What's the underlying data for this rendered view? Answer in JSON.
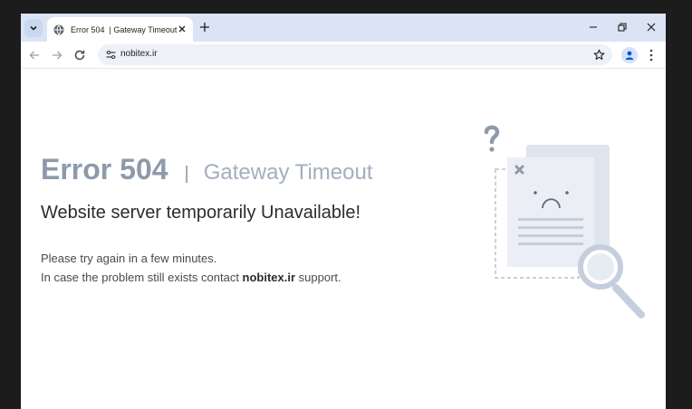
{
  "browser": {
    "tab_title": "Error 504  | Gateway Timeout",
    "url": "nobitex.ir"
  },
  "error": {
    "code": "Error 504",
    "separator": "|",
    "name": "Gateway Timeout",
    "subheading": "Website server temporarily Unavailable!",
    "line1": "Please try again in a few minutes.",
    "line2_prefix": "In case the problem still exists contact ",
    "line2_site": "nobitex.ir",
    "line2_suffix": " support."
  },
  "colors": {
    "tabstrip": "#dbe4f5",
    "heading": "#8c9aac",
    "illustration": "#c5cedc"
  }
}
